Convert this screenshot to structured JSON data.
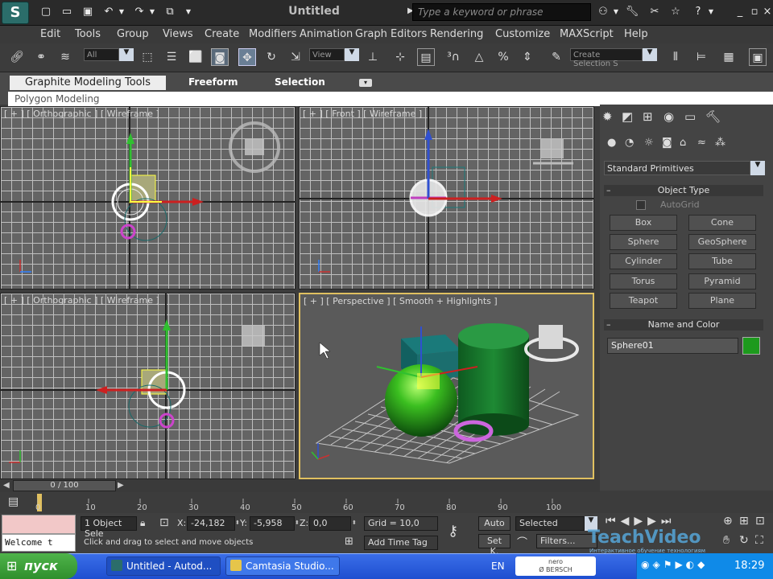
{
  "window": {
    "title": "Untitled",
    "search_placeholder": "Type a keyword or phrase"
  },
  "menu": [
    "Edit",
    "Tools",
    "Group",
    "Views",
    "Create",
    "Modifiers",
    "Animation",
    "Graph Editors",
    "Rendering",
    "Customize",
    "MAXScript",
    "Help"
  ],
  "toolbar": {
    "selection_filter": "All",
    "ref_coord": "View",
    "named_selection": "Create Selection S"
  },
  "ribbon": {
    "tabs": [
      "Graphite Modeling Tools",
      "Freeform",
      "Selection"
    ],
    "panel_label": "Polygon Modeling"
  },
  "viewports": {
    "top_left": "[ + ] [ Orthographic ] [ Wireframe ]",
    "top_right": "[ + ] [ Front ] [ Wireframe ]",
    "bottom_left": "[ + ] [ Orthographic ] [ Wireframe ]",
    "bottom_right": "[ + ] [ Perspective ] [ Smooth + Highlights ]"
  },
  "command_panel": {
    "category": "Standard Primitives",
    "object_type_header": "Object Type",
    "autogrid": "AutoGrid",
    "primitives": [
      "Box",
      "Cone",
      "Sphere",
      "GeoSphere",
      "Cylinder",
      "Tube",
      "Torus",
      "Pyramid",
      "Teapot",
      "Plane"
    ],
    "name_color_header": "Name and Color",
    "object_name": "Sphere01",
    "object_color": "#1d9a1d"
  },
  "timeline": {
    "frame": "0 / 100",
    "ticks": [
      "10",
      "20",
      "30",
      "40",
      "50",
      "60",
      "70",
      "80",
      "90",
      "100"
    ],
    "start_tick": "0"
  },
  "status": {
    "selection": "1 Object Sele",
    "x_label": "X:",
    "x": "-24,182",
    "y_label": "Y:",
    "y": "-5,958",
    "z_label": "Z:",
    "z": "0,0",
    "grid": "Grid = 10,0",
    "prompt": "Click and drag to select and move objects",
    "add_time_tag": "Add Time Tag",
    "auto": "Auto",
    "selected": "Selected",
    "setk": "Set K.",
    "filters": "Filters...",
    "maxscript_listener": "Welcome t"
  },
  "taskbar": {
    "start": "пуск",
    "tasks": [
      "Untitled - Autod...",
      "Camtasia Studio..."
    ],
    "lang": "EN",
    "nero_line1": "nero",
    "nero_line2": "Ø BEЯSCH",
    "clock": "18:29",
    "watermark": "TeachVideo",
    "watermark_sub": "Интерактивное обучение технологиям"
  }
}
